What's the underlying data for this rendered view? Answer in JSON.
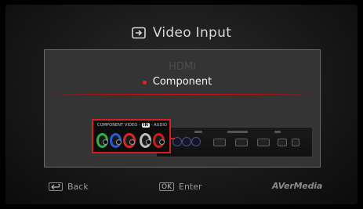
{
  "header": {
    "title": "Video Input",
    "icon": "input-source-icon"
  },
  "options": [
    {
      "label": "HDMI",
      "selected": false
    },
    {
      "label": "Component",
      "selected": true
    }
  ],
  "diagram": {
    "caption_prefix": "COMPONENT VIDEO -",
    "caption_tag": "IN",
    "caption_suffix": "- AUDIO",
    "highlight_color": "#d42020",
    "jack_colors": [
      "#2bb14d",
      "#2b5ad8",
      "#d42a2a",
      "#bdbdbd",
      "#c82020"
    ]
  },
  "footer": {
    "back": {
      "key": "back-arrow-icon",
      "label": "Back"
    },
    "enter": {
      "key": "OK",
      "label": "Enter"
    },
    "brand": "AVerMedia"
  }
}
